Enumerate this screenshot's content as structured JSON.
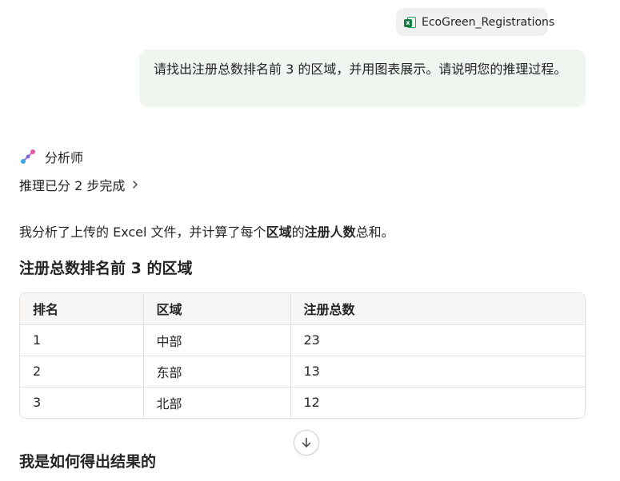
{
  "attachment": {
    "file_name": "EcoGreen_Registrations",
    "icon": "excel-file-icon",
    "icon_badge": "x"
  },
  "user_message": {
    "text": "请找出注册总数排名前 3 的区域，并用图表展示。请说明您的推理过程。"
  },
  "assistant": {
    "name": "分析师",
    "icon": "analyst-icon",
    "reasoning_label": "推理已分 2 步完成",
    "intro": {
      "part1": "我分析了上传的 Excel 文件，并计算了每个",
      "bold1": "区域",
      "part2": "的",
      "bold2": "注册人数",
      "part3": "总和。"
    },
    "table_heading": "注册总数排名前 3 的区域",
    "table": {
      "headers": [
        "排名",
        "区域",
        "注册总数"
      ],
      "rows": [
        [
          "1",
          "中部",
          "23"
        ],
        [
          "2",
          "东部",
          "13"
        ],
        [
          "3",
          "北部",
          "12"
        ]
      ]
    },
    "section_heading": "我是如何得出结果的"
  },
  "scroll_button": {
    "icon": "arrow-down-icon"
  },
  "colors": {
    "user_bubble": "#eef6ef",
    "attachment_chip": "#f0f0f0",
    "excel_green": "#107c41",
    "table_header_bg": "#f7f6f5",
    "border": "#e0e0e0",
    "text": "#242424"
  }
}
